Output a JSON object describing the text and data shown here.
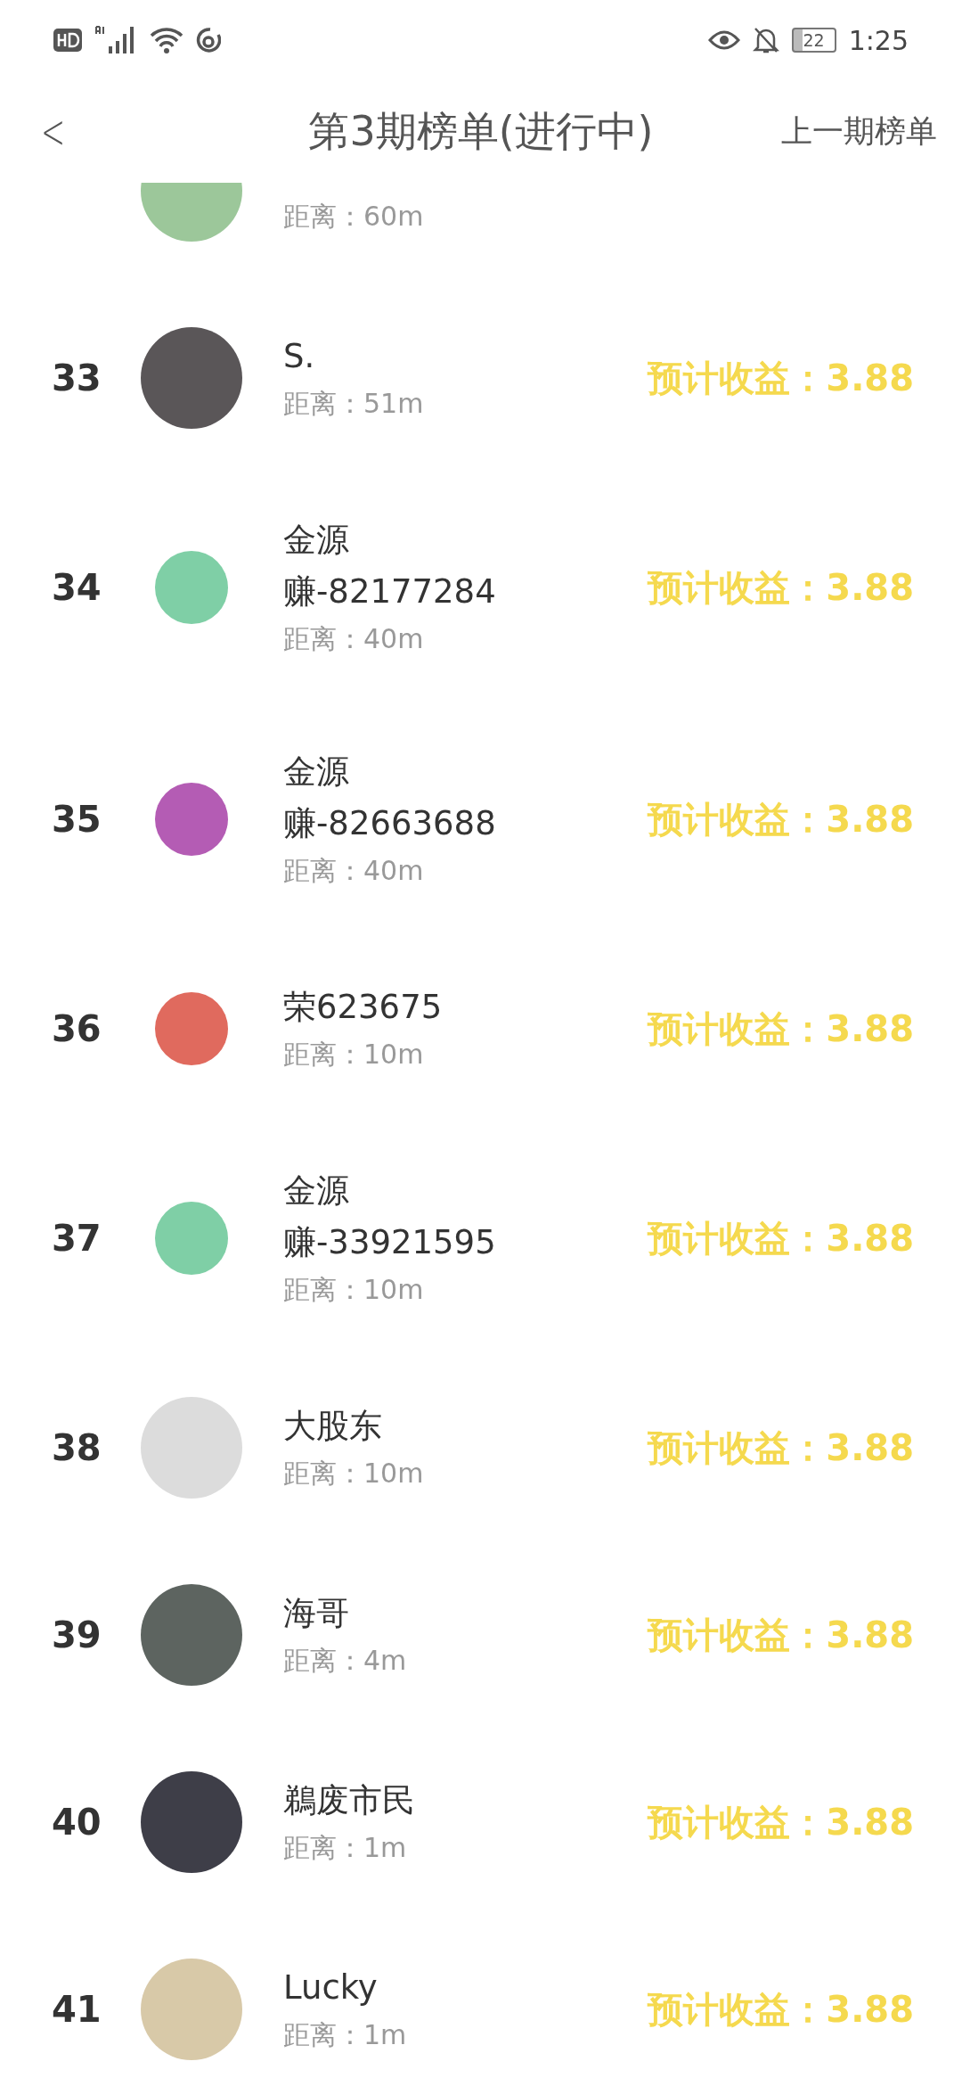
{
  "status_bar": {
    "battery": "22",
    "time": "1:25"
  },
  "header": {
    "back": "<",
    "title": "第3期榜单(进行中)",
    "action": "上一期榜单"
  },
  "rows": [
    {
      "kind": "partial",
      "distance": "距离：60m",
      "avatar": {
        "kind": "photo",
        "color": "#9cc79a"
      }
    },
    {
      "kind": "full",
      "rank": "33",
      "name": "S.",
      "distance": "距离：51m",
      "earnings": "预计收益：3.88",
      "avatar": {
        "kind": "photo",
        "color": "#5a5658"
      }
    },
    {
      "kind": "full",
      "rank": "34",
      "name_lines": [
        "金源",
        "赚-82177284"
      ],
      "distance": "距离：40m",
      "earnings": "预计收益：3.88",
      "avatar": {
        "kind": "cartoon",
        "color": "#7fcfa6"
      }
    },
    {
      "kind": "full",
      "rank": "35",
      "name_lines": [
        "金源",
        "赚-82663688"
      ],
      "distance": "距离：40m",
      "earnings": "预计收益：3.88",
      "avatar": {
        "kind": "cartoon",
        "color": "#b45cb4"
      }
    },
    {
      "kind": "full",
      "rank": "36",
      "name": "荣623675",
      "distance": "距离：10m",
      "earnings": "预计收益：3.88",
      "avatar": {
        "kind": "cartoon",
        "color": "#e06a5e"
      }
    },
    {
      "kind": "full",
      "rank": "37",
      "name_lines": [
        "金源",
        "赚-33921595"
      ],
      "distance": "距离：10m",
      "earnings": "预计收益：3.88",
      "avatar": {
        "kind": "cartoon",
        "color": "#7fcfa6"
      }
    },
    {
      "kind": "full",
      "rank": "38",
      "name": "大股东",
      "distance": "距离：10m",
      "earnings": "预计收益：3.88",
      "avatar": {
        "kind": "photo",
        "color": "#dcdcdc"
      }
    },
    {
      "kind": "full",
      "rank": "39",
      "name": "海哥",
      "distance": "距离：4m",
      "earnings": "预计收益：3.88",
      "avatar": {
        "kind": "photo",
        "color": "#5d6460"
      }
    },
    {
      "kind": "full",
      "rank": "40",
      "name": "鵜废市民",
      "distance": "距离：1m",
      "earnings": "预计收益：3.88",
      "avatar": {
        "kind": "photo",
        "color": "#3e3e48"
      }
    },
    {
      "kind": "full",
      "rank": "41",
      "name": "Lucky",
      "distance": "距离：1m",
      "earnings": "预计收益：3.88",
      "avatar": {
        "kind": "photo",
        "color": "#d8c9a8"
      }
    }
  ]
}
